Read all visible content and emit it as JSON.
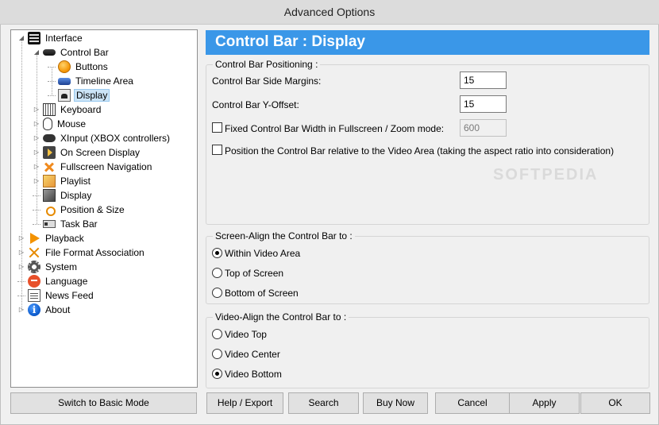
{
  "window": {
    "title": "Advanced Options"
  },
  "tree": [
    {
      "label": "Interface",
      "icon": "interface-icon",
      "level": 0,
      "expander": "open"
    },
    {
      "label": "Control Bar",
      "icon": "control-bar-icon",
      "level": 1,
      "expander": "open"
    },
    {
      "label": "Buttons",
      "icon": "buttons-icon",
      "level": 2,
      "expander": "none"
    },
    {
      "label": "Timeline Area",
      "icon": "timeline-icon",
      "level": 2,
      "expander": "none"
    },
    {
      "label": "Display",
      "icon": "display-icon",
      "level": 2,
      "expander": "none",
      "selected": true
    },
    {
      "label": "Keyboard",
      "icon": "keyboard-icon",
      "level": 1,
      "expander": "closed"
    },
    {
      "label": "Mouse",
      "icon": "mouse-icon",
      "level": 1,
      "expander": "closed"
    },
    {
      "label": "XInput (XBOX controllers)",
      "icon": "gamepad-icon",
      "level": 1,
      "expander": "closed"
    },
    {
      "label": "On Screen Display",
      "icon": "osd-icon",
      "level": 1,
      "expander": "closed"
    },
    {
      "label": "Fullscreen Navigation",
      "icon": "fullscreen-nav-icon",
      "level": 1,
      "expander": "closed"
    },
    {
      "label": "Playlist",
      "icon": "playlist-icon",
      "level": 1,
      "expander": "closed"
    },
    {
      "label": "Display",
      "icon": "monitor-icon",
      "level": 1,
      "expander": "none"
    },
    {
      "label": "Position & Size",
      "icon": "position-size-icon",
      "level": 1,
      "expander": "none"
    },
    {
      "label": "Task Bar",
      "icon": "taskbar-icon",
      "level": 1,
      "expander": "none"
    },
    {
      "label": "Playback",
      "icon": "playback-icon",
      "level": 0,
      "expander": "closed"
    },
    {
      "label": "File Format Association",
      "icon": "file-format-icon",
      "level": 0,
      "expander": "closed"
    },
    {
      "label": "System",
      "icon": "system-gear-icon",
      "level": 0,
      "expander": "closed"
    },
    {
      "label": "Language",
      "icon": "language-icon",
      "level": 0,
      "expander": "none"
    },
    {
      "label": "News Feed",
      "icon": "news-feed-icon",
      "level": 0,
      "expander": "none"
    },
    {
      "label": "About",
      "icon": "about-info-icon",
      "level": 0,
      "expander": "closed"
    }
  ],
  "panel": {
    "title": "Control Bar : Display",
    "positioning": {
      "legend": "Control Bar Positioning :",
      "side_margins_label": "Control Bar Side Margins:",
      "side_margins_value": "15",
      "y_offset_label": "Control Bar Y-Offset:",
      "y_offset_value": "15",
      "fixed_width_label": "Fixed Control Bar Width in Fullscreen / Zoom mode:",
      "fixed_width_checked": false,
      "fixed_width_value": "600",
      "relative_label": "Position the Control Bar relative to the Video Area (taking the aspect ratio into consideration)",
      "relative_checked": false
    },
    "screen_align": {
      "legend": "Screen-Align the Control Bar to :",
      "options": [
        {
          "label": "Within Video Area",
          "checked": true
        },
        {
          "label": "Top of Screen",
          "checked": false
        },
        {
          "label": "Bottom of Screen",
          "checked": false
        }
      ]
    },
    "video_align": {
      "legend": "Video-Align the Control Bar to :",
      "options": [
        {
          "label": "Video Top",
          "checked": false
        },
        {
          "label": "Video Center",
          "checked": false
        },
        {
          "label": "Video Bottom",
          "checked": true
        }
      ]
    }
  },
  "buttons": {
    "basic_mode": "Switch to Basic Mode",
    "help_export": "Help / Export",
    "search": "Search",
    "buy_now": "Buy Now",
    "cancel": "Cancel",
    "apply": "Apply",
    "ok": "OK"
  },
  "watermark": "SOFTPEDIA"
}
